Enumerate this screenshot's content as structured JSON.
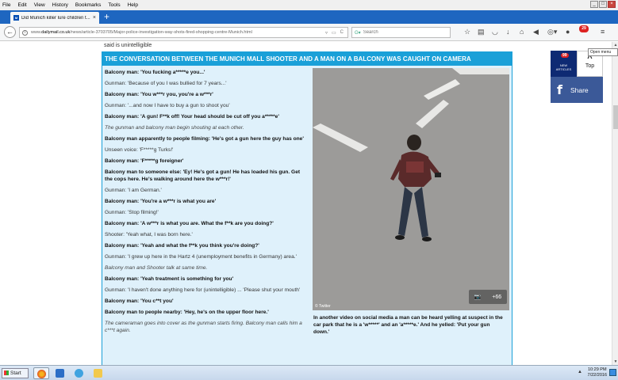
{
  "menubar": {
    "items": [
      "File",
      "Edit",
      "View",
      "History",
      "Bookmarks",
      "Tools",
      "Help"
    ]
  },
  "tab": {
    "title": "Did Munich killer lure children t...",
    "close": "×",
    "new_tab": "+"
  },
  "navbar": {
    "url_prefix": "www.",
    "url_domain": "dailymail.co.uk",
    "url_path": "/news/article-3703705/Major-police-investigation-way-shots-fired-shopping-centre-Munich.html",
    "search_placeholder": "Search",
    "notification_count": "29",
    "tooltip": "Open menu"
  },
  "article": {
    "top_line": "said is unintelligible",
    "header": "THE CONVERSATION BETWEEN THE MUNICH MALL SHOOTER AND A MAN ON A BALCONY WAS CAUGHT ON CAMERA",
    "lines": [
      {
        "text": "Balcony man: 'You fucking a*****e you...'",
        "style": "b"
      },
      {
        "text": "Gunman: 'Because of you I was bullied for 7 years...'",
        "style": "n"
      },
      {
        "text": "Balcony man: 'You w***r you, you're a w***r'",
        "style": "b"
      },
      {
        "text": "Gunman: '...and now I have to buy a gun to shoot you'",
        "style": "n"
      },
      {
        "text": "Balcony man: 'A gun! F**k off! Your head should be cut off you a*****e'",
        "style": "b"
      },
      {
        "text": "The gunman and balcony man begin shouting at each other.",
        "style": "i"
      },
      {
        "text": "Balcony man apparently to people filming: 'He's got a gun here the guy has one'",
        "style": "b"
      },
      {
        "text": "Unseen voice: 'F*****g Turks!'",
        "style": "n"
      },
      {
        "text": "Balcony man: 'F*****g foreigner'",
        "style": "b"
      },
      {
        "text": "Balcony man to someone else: 'Ey! He's got a gun! He has loaded his gun. Get the cops here. He's walking around here the w***r!'",
        "style": "b"
      },
      {
        "text": "Gunman: 'I am German.'",
        "style": "n"
      },
      {
        "text": "Balcony man: 'You're a w***r is what you are'",
        "style": "b"
      },
      {
        "text": "Gunman: 'Stop filming!'",
        "style": "n"
      },
      {
        "text": "Balcony man: 'A w***r is what you are. What the f**k are you doing?'",
        "style": "b"
      },
      {
        "text": "Shooter: 'Yeah what, I was born here.'",
        "style": "n"
      },
      {
        "text": "Balcony man: 'Yeah and what the f**k you think you're doing?'",
        "style": "b"
      },
      {
        "text": "Gunman: 'I grew up here in the Hartz 4 (unemployment benefits in Germany) area.'",
        "style": "n"
      },
      {
        "text": "Balcony man and Shooter talk at same time.",
        "style": "i"
      },
      {
        "text": "Balcony man: 'Yeah treatment is something for you'",
        "style": "b"
      },
      {
        "text": "Gunman: 'I haven't done anything here for (unintelligible) ... 'Please shut your mouth'",
        "style": "n"
      },
      {
        "text": "Balcony man: 'You c**t you'",
        "style": "b"
      },
      {
        "text": "Balcony man to people nearby: 'Hey, he's on the upper floor here.'",
        "style": "b"
      },
      {
        "text": "The cameraman goes into cover as the gunman starts firing. Balcony man calls him a c***t again.",
        "style": "i"
      }
    ],
    "photo_credit": "© Twitter",
    "photo_count": "+66",
    "caption": "In another video on social media a man can be heard yelling at suspect in the car park that he is a 'w*****' and an 'a*****e.' And he yelled: 'Put your gun down.'"
  },
  "widget": {
    "new_count": "99",
    "new_label_1": "NEW",
    "new_label_2": "ARTICLES",
    "top_label": "Top",
    "share_label": "Share"
  },
  "taskbar": {
    "start": "Start",
    "time": "10:29 PM",
    "date": "7/22/2016"
  }
}
